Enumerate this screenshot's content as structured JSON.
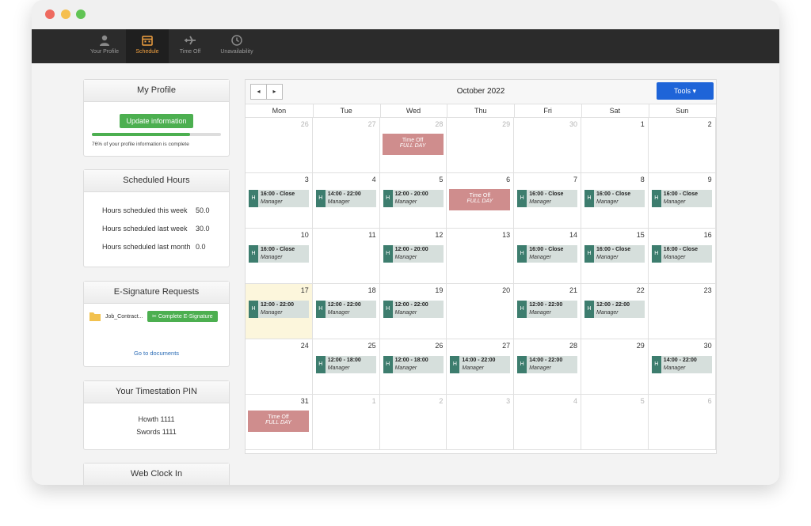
{
  "nav": [
    {
      "label": "Your Profile",
      "icon": "person-icon"
    },
    {
      "label": "Schedule",
      "icon": "calendar-icon"
    },
    {
      "label": "Time Off",
      "icon": "airplane-icon"
    },
    {
      "label": "Unavailability",
      "icon": "clock-icon"
    }
  ],
  "profile": {
    "title": "My Profile",
    "button": "Update information",
    "progress": 0.76,
    "note": "76% of your profile information is complete"
  },
  "hours": {
    "title": "Scheduled Hours",
    "rows": [
      {
        "label": "Hours scheduled this week",
        "value": "50.0"
      },
      {
        "label": "Hours scheduled last week",
        "value": "30.0"
      },
      {
        "label": "Hours scheduled last month",
        "value": "0.0"
      }
    ]
  },
  "esign": {
    "title": "E-Signature Requests",
    "file": "Job_Contract...",
    "button": "Complete E-Signature",
    "link": "Go to documents"
  },
  "pin": {
    "title": "Your Timestation PIN",
    "rows": [
      "Howth  1111",
      "Swords 1111"
    ]
  },
  "clock": {
    "title": "Web Clock In"
  },
  "calendar": {
    "title": "October 2022",
    "prev": "◂",
    "next": "▸",
    "tools": "Tools ▾",
    "days": [
      "Mon",
      "Tue",
      "Wed",
      "Thu",
      "Fri",
      "Sat",
      "Sun"
    ],
    "weeks": [
      [
        {
          "d": "26",
          "o": true
        },
        {
          "d": "27",
          "o": true
        },
        {
          "d": "28",
          "o": true,
          "off": true
        },
        {
          "d": "29",
          "o": true
        },
        {
          "d": "30",
          "o": true
        },
        {
          "d": "1"
        },
        {
          "d": "2"
        }
      ],
      [
        {
          "d": "3",
          "ev": "16:00 - Close"
        },
        {
          "d": "4",
          "ev": "14:00 - 22:00"
        },
        {
          "d": "5",
          "ev": "12:00 - 20:00"
        },
        {
          "d": "6",
          "off": true
        },
        {
          "d": "7",
          "ev": "16:00 - Close"
        },
        {
          "d": "8",
          "ev": "16:00 - Close"
        },
        {
          "d": "9",
          "ev": "16:00 - Close"
        }
      ],
      [
        {
          "d": "10",
          "ev": "16:00 - Close"
        },
        {
          "d": "11"
        },
        {
          "d": "12",
          "ev": "12:00 - 20:00"
        },
        {
          "d": "13"
        },
        {
          "d": "14",
          "ev": "16:00 - Close"
        },
        {
          "d": "15",
          "ev": "16:00 - Close"
        },
        {
          "d": "16",
          "ev": "16:00 - Close"
        }
      ],
      [
        {
          "d": "17",
          "ev": "12:00 - 22:00",
          "today": true
        },
        {
          "d": "18",
          "ev": "12:00 - 22:00"
        },
        {
          "d": "19",
          "ev": "12:00 - 22:00"
        },
        {
          "d": "20"
        },
        {
          "d": "21",
          "ev": "12:00 - 22:00"
        },
        {
          "d": "22",
          "ev": "12:00 - 22:00"
        },
        {
          "d": "23"
        }
      ],
      [
        {
          "d": "24"
        },
        {
          "d": "25",
          "ev": "12:00 - 18:00"
        },
        {
          "d": "26",
          "ev": "12:00 - 18:00"
        },
        {
          "d": "27",
          "ev": "14:00 - 22:00"
        },
        {
          "d": "28",
          "ev": "14:00 - 22:00"
        },
        {
          "d": "29"
        },
        {
          "d": "30",
          "ev": "14:00 - 22:00"
        }
      ],
      [
        {
          "d": "31",
          "off": true
        },
        {
          "d": "1",
          "o": true
        },
        {
          "d": "2",
          "o": true
        },
        {
          "d": "3",
          "o": true
        },
        {
          "d": "4",
          "o": true
        },
        {
          "d": "5",
          "o": true
        },
        {
          "d": "6",
          "o": true
        }
      ]
    ],
    "event_badge": "H",
    "event_role": "Manager",
    "off_title": "Time Off",
    "off_sub": "FULL DAY"
  }
}
